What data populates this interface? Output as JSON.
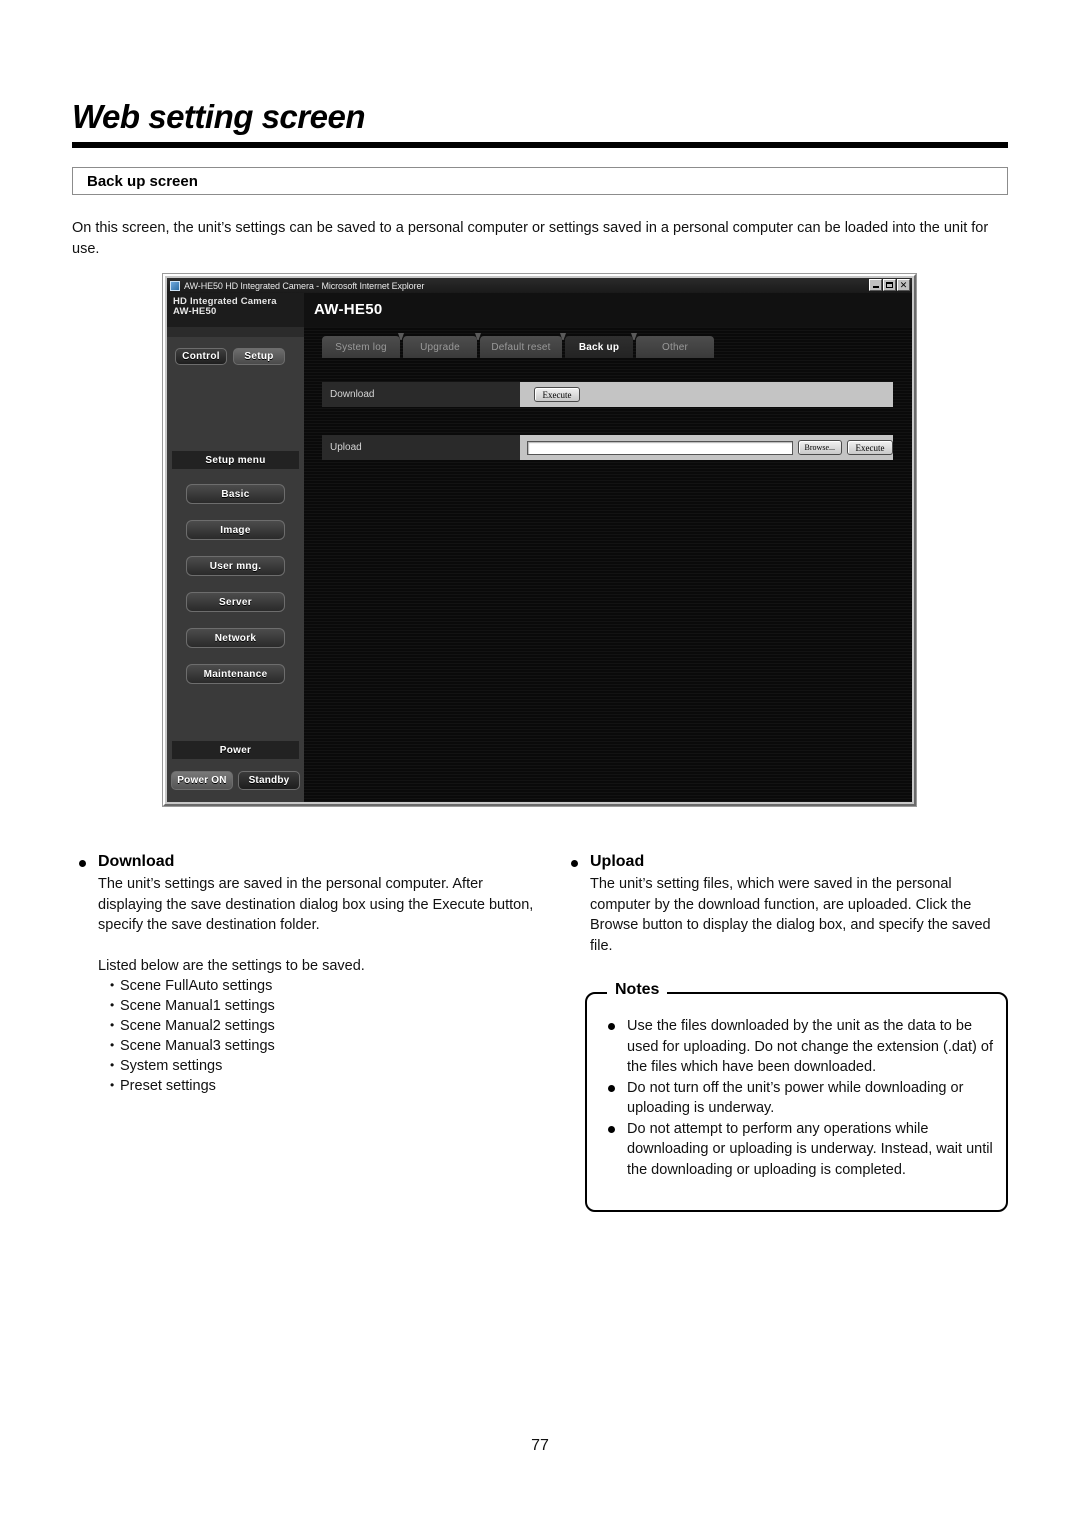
{
  "document": {
    "page_title": "Web setting screen",
    "section_heading": "Back up screen",
    "intro": "On this screen, the unit’s settings can be saved to a personal computer or settings saved in a personal computer can be loaded into the unit for use.",
    "page_number": "77"
  },
  "browser": {
    "window_title": "AW-HE50 HD Integrated Camera - Microsoft Internet Explorer",
    "window_controls": {
      "minimize": "_",
      "maximize": "□",
      "close": "✕"
    },
    "brand": {
      "line1": "HD Integrated Camera",
      "line2": "AW-HE50",
      "model": "AW-HE50"
    },
    "sidebar": {
      "mode_buttons": [
        {
          "label": "Control",
          "active": false
        },
        {
          "label": "Setup",
          "active": true
        }
      ],
      "setup_menu_heading": "Setup menu",
      "menu_items": [
        {
          "label": "Basic"
        },
        {
          "label": "Image"
        },
        {
          "label": "User mng."
        },
        {
          "label": "Server"
        },
        {
          "label": "Network"
        },
        {
          "label": "Maintenance"
        }
      ],
      "power_heading": "Power",
      "power_buttons": [
        {
          "label": "Power ON",
          "active": true
        },
        {
          "label": "Standby",
          "active": false
        }
      ]
    },
    "tabs": [
      {
        "label": "System log",
        "active": false
      },
      {
        "label": "Upgrade",
        "active": false
      },
      {
        "label": "Default reset",
        "active": false
      },
      {
        "label": "Back up",
        "active": true
      },
      {
        "label": "Other",
        "active": false
      }
    ],
    "rows": [
      {
        "label": "Download",
        "execute_label": "Execute"
      },
      {
        "label": "Upload",
        "input_value": "",
        "browse_label": "Browse...",
        "execute_label": "Execute"
      }
    ]
  },
  "download_section": {
    "heading": "Download",
    "paragraph": "The unit’s settings are saved in the personal computer. After displaying the save destination dialog box using the Execute button, specify the save destination folder.",
    "list_intro": "Listed below are the settings to be saved.",
    "items": [
      "Scene FullAuto settings",
      "Scene Manual1 settings",
      "Scene Manual2 settings",
      "Scene Manual3 settings",
      "System settings",
      "Preset settings"
    ]
  },
  "upload_section": {
    "heading": "Upload",
    "paragraph": "The unit’s setting files, which were saved in the personal computer by the download function, are uploaded. Click the Browse button to display the dialog box, and specify the saved file."
  },
  "notes": {
    "title": "Notes",
    "items": [
      "Use the files downloaded by the unit as the data to be used for uploading. Do not change the extension (.dat) of the files which have been downloaded.",
      "Do not turn off the unit’s power while downloading or uploading is underway.",
      "Do not attempt to perform any operations while downloading or uploading is underway. Instead, wait until the downloading or uploading is completed."
    ]
  },
  "colors": {
    "rule": "#000000",
    "sidebar_bg": "#3a3a3a",
    "content_bg": "#0d0d0d",
    "field_bg": "#c4c4c4"
  }
}
